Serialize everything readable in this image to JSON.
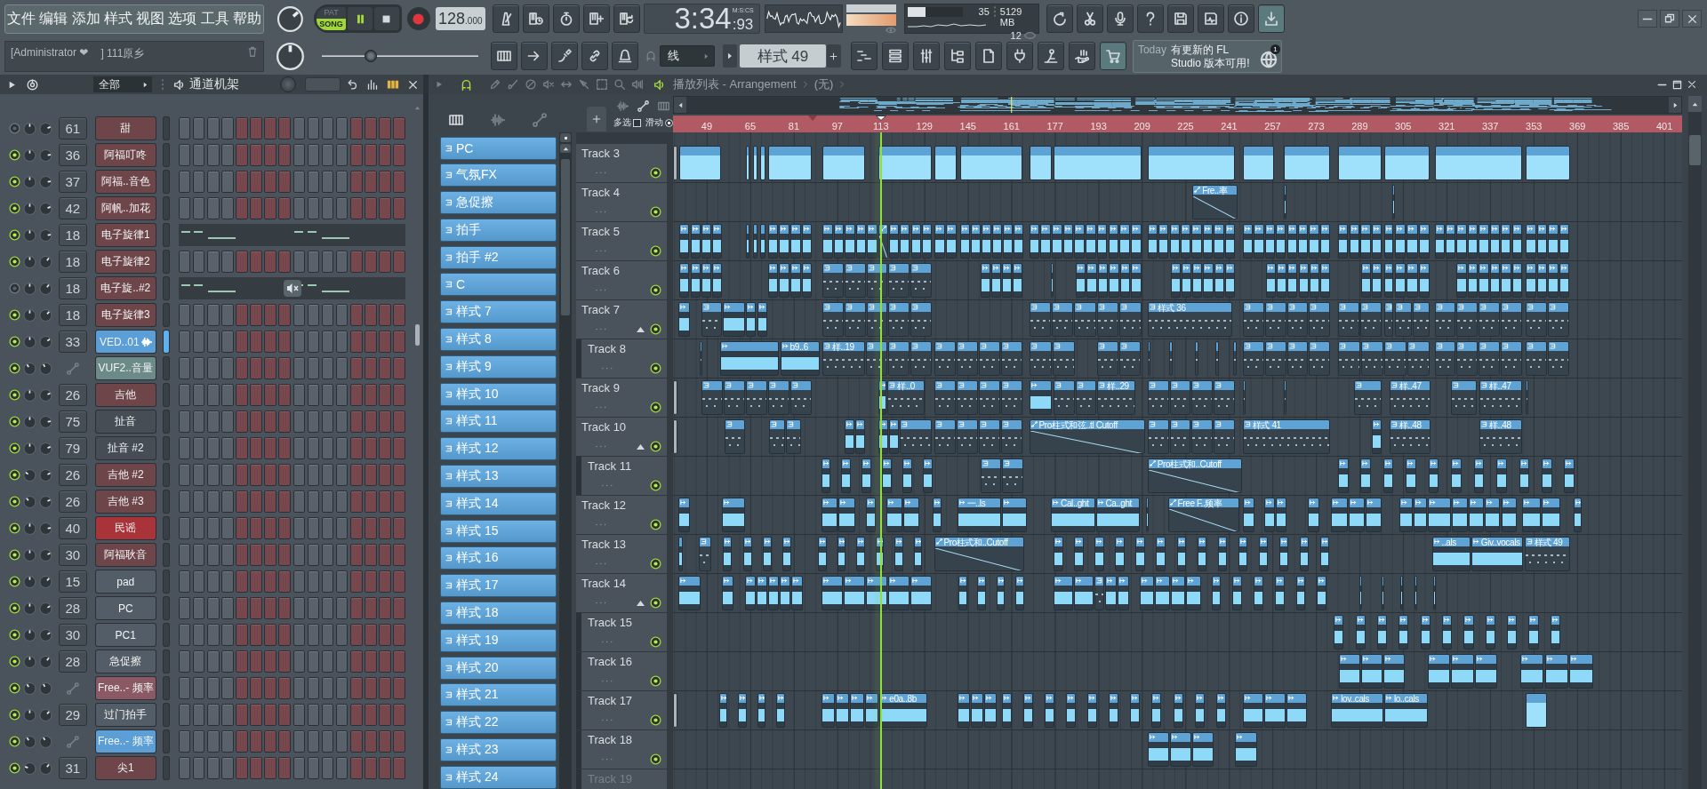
{
  "menu": [
    "文件",
    "编辑",
    "添加",
    "样式",
    "视图",
    "选项",
    "工具",
    "帮助"
  ],
  "hint": [
    "[Administrator ❤",
    "] 111原乡"
  ],
  "master_volume": {
    "level": 0.68
  },
  "master_pitch": {
    "level": 0.5
  },
  "transport": {
    "modes": [
      {
        "label": "PAT",
        "selected": false
      },
      {
        "label": "SONG",
        "selected": true
      }
    ],
    "playing": true,
    "tempo": "128",
    "tempo_fraction": ".000"
  },
  "song_position": {
    "level": 0.3
  },
  "record_tools": [
    {
      "kind": "metronome"
    },
    {
      "kind": "wait"
    },
    {
      "kind": "countdown"
    },
    {
      "kind": "step"
    },
    {
      "kind": "loop"
    }
  ],
  "time": {
    "value": "3:34",
    "centiseconds": ":93",
    "unit": "M:S:CS"
  },
  "cpu": {
    "value": "35",
    "level": 0.32,
    "memory": "5129 MB",
    "polyphony": "12"
  },
  "app_tools": [
    {
      "kind": "reload",
      "highlighted": false
    },
    {
      "kind": "cut",
      "highlighted": false
    },
    {
      "kind": "mic",
      "highlighted": false
    },
    {
      "kind": "help",
      "highlighted": false
    },
    {
      "kind": "save",
      "highlighted": false
    },
    {
      "kind": "export",
      "highlighted": false
    },
    {
      "kind": "info",
      "highlighted": false
    },
    {
      "kind": "download",
      "highlighted": true
    }
  ],
  "edit_tools": [
    {
      "kind": "keyboard"
    },
    {
      "kind": "arrow"
    },
    {
      "kind": "pen"
    },
    {
      "kind": "link"
    },
    {
      "kind": "bell"
    }
  ],
  "snap": "线",
  "pattern_selector": "样式 49",
  "view_tools": [
    {
      "kind": "playlist",
      "highlighted": false
    },
    {
      "kind": "list",
      "highlighted": false
    },
    {
      "kind": "mixer",
      "highlighted": false
    },
    {
      "kind": "browser",
      "highlighted": false
    },
    {
      "kind": "page",
      "highlighted": false
    },
    {
      "kind": "plug",
      "highlighted": false
    },
    {
      "kind": "figure",
      "highlighted": false
    },
    {
      "kind": "hand",
      "highlighted": false
    },
    {
      "kind": "cart",
      "highlighted": true
    }
  ],
  "news": {
    "label": "Today",
    "message": "有更新的 FL Studio 版本可用!",
    "badge": "1"
  },
  "channel_rack": {
    "filter": "全部",
    "title": "通道机架",
    "channels": [
      {
        "number": "61",
        "name": "甜",
        "kind": "sampler",
        "color": "#6e4649",
        "enabled": false,
        "selected": false,
        "pan": {
          "level": 0.5
        },
        "volume": {
          "level": 0.75
        }
      },
      {
        "number": "36",
        "name": "阿福叮咚",
        "kind": "sampler",
        "color": "#6e4649",
        "enabled": true,
        "selected": false,
        "pan": {
          "level": 0.5
        },
        "volume": {
          "level": 0.8
        }
      },
      {
        "number": "37",
        "name": "阿福..音色",
        "kind": "sampler",
        "color": "#6e4649",
        "enabled": true,
        "selected": false,
        "pan": {
          "level": 0.5
        },
        "volume": {
          "level": 0.8
        }
      },
      {
        "number": "42",
        "name": "阿帆..加花",
        "kind": "sampler",
        "color": "#6e4649",
        "enabled": true,
        "selected": false,
        "pan": {
          "level": 0.5
        },
        "volume": {
          "level": 0.75
        }
      },
      {
        "number": "18",
        "name": "电子旋律1",
        "kind": "pianoroll",
        "color": "#6e4649",
        "enabled": true,
        "selected": false,
        "pan": {
          "level": 0.5
        },
        "volume": {
          "level": 0.8
        }
      },
      {
        "number": "18",
        "name": "电子旋律2",
        "kind": "sampler",
        "color": "#6e4649",
        "enabled": true,
        "selected": false,
        "pan": {
          "level": 0.5
        },
        "volume": {
          "level": 0.64
        }
      },
      {
        "number": "18",
        "name": "电子旋..#2",
        "kind": "pianoroll",
        "color": "#6e4649",
        "enabled": false,
        "selected": false,
        "pan": {
          "level": 0.5
        },
        "volume": {
          "level": 0.64
        }
      },
      {
        "number": "18",
        "name": "电子旋律3",
        "kind": "sampler",
        "color": "#6e4649",
        "enabled": true,
        "selected": false,
        "pan": {
          "level": 0.5
        },
        "volume": {
          "level": 0.66
        }
      },
      {
        "number": "33",
        "name": "VED..01",
        "kind": "audio",
        "color": "#5b9fd6",
        "enabled": true,
        "selected": true,
        "pan": {
          "level": 0.5
        },
        "volume": {
          "level": 0.7
        }
      },
      {
        "name": "VUF2..音量",
        "kind": "automation",
        "color": "#6b8a88",
        "enabled": true,
        "selected": false,
        "pan": {
          "level": 0.38
        },
        "volume": {
          "level": 0.4
        }
      },
      {
        "number": "26",
        "name": "吉他",
        "kind": "sampler",
        "color": "#6e4649",
        "enabled": true,
        "selected": false,
        "pan": {
          "level": 0.5
        },
        "volume": {
          "level": 0.74
        }
      },
      {
        "number": "75",
        "name": "扯音",
        "kind": "sampler",
        "color": "#464d54",
        "enabled": true,
        "selected": false,
        "pan": {
          "level": 0.5
        },
        "volume": {
          "level": 0.8
        }
      },
      {
        "number": "79",
        "name": "扯音 #2",
        "kind": "sampler",
        "color": "#464d54",
        "enabled": true,
        "selected": false,
        "pan": {
          "level": 0.5
        },
        "volume": {
          "level": 0.75
        }
      },
      {
        "number": "26",
        "name": "吉他 #2",
        "kind": "sampler",
        "color": "#6e4649",
        "enabled": true,
        "selected": false,
        "pan": {
          "level": 0.3
        },
        "volume": {
          "level": 0.74
        }
      },
      {
        "number": "26",
        "name": "吉他 #3",
        "kind": "sampler",
        "color": "#6e4649",
        "enabled": true,
        "selected": false,
        "pan": {
          "level": 0.35
        },
        "volume": {
          "level": 0.74
        }
      },
      {
        "number": "40",
        "name": "民谣",
        "kind": "sampler",
        "color": "#a83439",
        "enabled": true,
        "selected": false,
        "pan": {
          "level": 0.5
        },
        "volume": {
          "level": 0.8
        }
      },
      {
        "number": "30",
        "name": "阿福耿音",
        "kind": "sampler",
        "color": "#6e4649",
        "enabled": true,
        "selected": false,
        "pan": {
          "level": 0.5
        },
        "volume": {
          "level": 0.74
        }
      },
      {
        "number": "15",
        "name": "pad",
        "kind": "sampler",
        "color": "#535d67",
        "enabled": true,
        "selected": false,
        "pan": {
          "level": 0.5
        },
        "volume": {
          "level": 0.66
        }
      },
      {
        "number": "28",
        "name": "PC",
        "kind": "sampler",
        "color": "#535d67",
        "enabled": true,
        "selected": false,
        "pan": {
          "level": 0.5
        },
        "volume": {
          "level": 0.72
        }
      },
      {
        "number": "30",
        "name": "PC1",
        "kind": "sampler",
        "color": "#535d67",
        "enabled": true,
        "selected": false,
        "pan": {
          "level": 0.5
        },
        "volume": {
          "level": 0.72
        }
      },
      {
        "number": "28",
        "name": "急促擦",
        "kind": "sampler",
        "color": "#535d67",
        "enabled": true,
        "selected": false,
        "pan": {
          "level": 0.5
        },
        "volume": {
          "level": 0.64
        }
      },
      {
        "name": "Free..- 频率",
        "kind": "automation",
        "color": "#8b5963",
        "enabled": true,
        "selected": false,
        "pan": {
          "level": 0.38
        },
        "volume": {
          "level": 0.4
        }
      },
      {
        "number": "29",
        "name": "过门拍手",
        "kind": "sampler",
        "color": "#535d67",
        "enabled": true,
        "selected": false,
        "pan": {
          "level": 0.5
        },
        "volume": {
          "level": 0.66
        }
      },
      {
        "name": "Free..- 频率",
        "kind": "automation",
        "color": "#5b9fd6",
        "enabled": true,
        "selected": false,
        "pan": {
          "level": 0.38
        },
        "volume": {
          "level": 0.4
        }
      },
      {
        "number": "31",
        "name": "尖1",
        "kind": "sampler",
        "color": "#6e4649",
        "enabled": true,
        "selected": false,
        "pan": {
          "level": 0.25
        },
        "volume": {
          "level": 0.64
        }
      }
    ]
  },
  "pattern_picker": {
    "tabs": [
      {
        "kind": "patterns",
        "selected": true
      },
      {
        "kind": "audio",
        "selected": false
      },
      {
        "kind": "automation",
        "selected": false
      }
    ],
    "patterns": [
      "PC",
      "气氛FX",
      "急促擦",
      "拍手",
      "拍手 #2",
      "C",
      "样式 7",
      "样式 8",
      "样式 9",
      "样式 10",
      "样式 11",
      "样式 12",
      "样式 13",
      "样式 14",
      "样式 15",
      "样式 16",
      "样式 17",
      "样式 18",
      "样式 19",
      "样式 20",
      "样式 21",
      "样式 22",
      "样式 23",
      "样式 24"
    ]
  },
  "playlist": {
    "title": "播放列表 - Arrangement",
    "arrangement": "(无)",
    "options": [
      {
        "kind": "checkbox",
        "label": "多选",
        "checked": false
      },
      {
        "kind": "radio",
        "label": "滑动",
        "checked": true
      }
    ],
    "ruler": [
      "49",
      "65",
      "81",
      "97",
      "113",
      "129",
      "145",
      "161",
      "177",
      "193",
      "209",
      "225",
      "241",
      "257",
      "273",
      "289",
      "305",
      "321",
      "337",
      "353",
      "369",
      "385",
      "401"
    ],
    "tracks": [
      {
        "name": "Track 3",
        "enabled": true,
        "clips": [
          {
            "kind": "ghost"
          },
          {
            "kind": "sample"
          },
          {
            "kind": "sample"
          },
          {
            "kind": "sample"
          },
          {
            "kind": "sample"
          },
          {
            "kind": "sample"
          },
          {
            "kind": "sample"
          },
          {
            "kind": "sample"
          },
          {
            "kind": "sample"
          },
          {
            "kind": "sample"
          },
          {
            "kind": "sample"
          },
          {
            "kind": "sample"
          },
          {
            "kind": "sample"
          },
          {
            "kind": "sample"
          },
          {
            "kind": "sample"
          },
          {
            "kind": "sample"
          },
          {
            "kind": "sample"
          },
          {
            "kind": "sample"
          },
          {
            "kind": "sample"
          }
        ]
      },
      {
        "name": "Track 4",
        "enabled": true,
        "clips": [
          {
            "kind": "automation",
            "label": "Fre..率"
          },
          {
            "kind": "audio"
          },
          {
            "kind": "audio"
          }
        ]
      },
      {
        "name": "Track 5",
        "enabled": true,
        "clips": [
          {
            "kind": "audio"
          },
          {
            "kind": "audio"
          },
          {
            "kind": "audio"
          },
          {
            "kind": "audio"
          },
          {
            "kind": "audio"
          },
          {
            "kind": "audio"
          },
          {
            "kind": "audio"
          },
          {
            "kind": "audio"
          },
          {
            "kind": "audio"
          },
          {
            "kind": "audio"
          },
          {
            "kind": "audio"
          },
          {
            "kind": "audio"
          },
          {
            "kind": "audio"
          },
          {
            "kind": "audio"
          },
          {
            "kind": "audio"
          },
          {
            "kind": "audio"
          },
          {
            "kind": "automation"
          },
          {
            "kind": "audio"
          },
          {
            "kind": "audio"
          },
          {
            "kind": "audio"
          },
          {
            "kind": "audio"
          },
          {
            "kind": "audio"
          },
          {
            "kind": "audio"
          },
          {
            "kind": "audio"
          },
          {
            "kind": "audio"
          },
          {
            "kind": "audio"
          },
          {
            "kind": "audio"
          },
          {
            "kind": "audio"
          },
          {
            "kind": "audio"
          },
          {
            "kind": "audio"
          },
          {
            "kind": "audio"
          },
          {
            "kind": "audio"
          },
          {
            "kind": "audio"
          },
          {
            "kind": "audio"
          },
          {
            "kind": "audio"
          },
          {
            "kind": "audio"
          },
          {
            "kind": "audio"
          },
          {
            "kind": "audio"
          },
          {
            "kind": "audio"
          },
          {
            "kind": "audio"
          },
          {
            "kind": "audio"
          },
          {
            "kind": "audio"
          },
          {
            "kind": "audio"
          },
          {
            "kind": "audio"
          },
          {
            "kind": "audio"
          },
          {
            "kind": "audio"
          },
          {
            "kind": "audio"
          },
          {
            "kind": "audio"
          },
          {
            "kind": "audio"
          },
          {
            "kind": "audio"
          },
          {
            "kind": "audio"
          },
          {
            "kind": "audio"
          },
          {
            "kind": "audio"
          },
          {
            "kind": "audio"
          },
          {
            "kind": "audio"
          },
          {
            "kind": "audio"
          },
          {
            "kind": "audio"
          },
          {
            "kind": "audio"
          },
          {
            "kind": "audio"
          },
          {
            "kind": "audio"
          },
          {
            "kind": "audio"
          },
          {
            "kind": "audio"
          },
          {
            "kind": "audio"
          },
          {
            "kind": "audio"
          },
          {
            "kind": "audio"
          },
          {
            "kind": "audio"
          },
          {
            "kind": "audio"
          },
          {
            "kind": "audio"
          },
          {
            "kind": "audio"
          },
          {
            "kind": "audio"
          },
          {
            "kind": "audio"
          },
          {
            "kind": "audio"
          },
          {
            "kind": "audio"
          },
          {
            "kind": "audio"
          },
          {
            "kind": "audio"
          }
        ]
      },
      {
        "name": "Track 6",
        "enabled": true,
        "clips": [
          {
            "kind": "audio"
          },
          {
            "kind": "audio"
          },
          {
            "kind": "audio"
          },
          {
            "kind": "audio"
          },
          {
            "kind": "audio"
          },
          {
            "kind": "audio"
          },
          {
            "kind": "audio"
          },
          {
            "kind": "audio"
          },
          {
            "kind": "pattern"
          },
          {
            "kind": "pattern"
          },
          {
            "kind": "pattern"
          },
          {
            "kind": "pattern"
          },
          {
            "kind": "pattern"
          },
          {
            "kind": "audio"
          },
          {
            "kind": "audio"
          },
          {
            "kind": "audio"
          },
          {
            "kind": "audio"
          },
          {
            "kind": "audio"
          },
          {
            "kind": "audio"
          },
          {
            "kind": "audio"
          },
          {
            "kind": "audio"
          },
          {
            "kind": "audio"
          },
          {
            "kind": "audio"
          },
          {
            "kind": "audio"
          },
          {
            "kind": "audio"
          },
          {
            "kind": "audio"
          },
          {
            "kind": "audio"
          },
          {
            "kind": "audio"
          },
          {
            "kind": "audio"
          },
          {
            "kind": "audio"
          },
          {
            "kind": "audio"
          },
          {
            "kind": "audio"
          },
          {
            "kind": "audio"
          },
          {
            "kind": "audio"
          },
          {
            "kind": "audio"
          },
          {
            "kind": "audio"
          },
          {
            "kind": "audio"
          },
          {
            "kind": "audio"
          },
          {
            "kind": "audio"
          },
          {
            "kind": "audio"
          },
          {
            "kind": "audio"
          },
          {
            "kind": "audio"
          },
          {
            "kind": "audio"
          },
          {
            "kind": "audio"
          },
          {
            "kind": "audio"
          },
          {
            "kind": "audio"
          },
          {
            "kind": "audio"
          },
          {
            "kind": "audio"
          },
          {
            "kind": "audio"
          },
          {
            "kind": "audio"
          },
          {
            "kind": "audio"
          },
          {
            "kind": "audio"
          }
        ]
      },
      {
        "name": "Track 7",
        "enabled": true,
        "expanded": true,
        "clips": [
          {
            "kind": "audio"
          },
          {
            "kind": "pattern"
          },
          {
            "kind": "audio"
          },
          {
            "kind": "audio"
          },
          {
            "kind": "audio"
          },
          {
            "kind": "pattern"
          },
          {
            "kind": "pattern"
          },
          {
            "kind": "pattern"
          },
          {
            "kind": "pattern"
          },
          {
            "kind": "pattern"
          },
          {
            "kind": "pattern"
          },
          {
            "kind": "pattern"
          },
          {
            "kind": "pattern"
          },
          {
            "kind": "pattern"
          },
          {
            "kind": "pattern"
          },
          {
            "kind": "pattern",
            "label": "样式 36"
          },
          {
            "kind": "pattern"
          },
          {
            "kind": "pattern"
          },
          {
            "kind": "pattern"
          },
          {
            "kind": "pattern"
          },
          {
            "kind": "pattern"
          },
          {
            "kind": "pattern"
          },
          {
            "kind": "pattern"
          },
          {
            "kind": "pattern"
          },
          {
            "kind": "pattern"
          },
          {
            "kind": "pattern"
          },
          {
            "kind": "pattern"
          },
          {
            "kind": "pattern"
          },
          {
            "kind": "pattern"
          },
          {
            "kind": "pattern"
          },
          {
            "kind": "pattern"
          }
        ],
        "children": [
          {
            "name": "Track 8",
            "enabled": true,
            "clips": [
              {
                "kind": "pattern"
              },
              {
                "kind": "audio"
              },
              {
                "kind": "audio",
                "label": "b9..6"
              },
              {
                "kind": "pattern",
                "label": "样..19"
              },
              {
                "kind": "pattern"
              },
              {
                "kind": "pattern"
              },
              {
                "kind": "pattern"
              },
              {
                "kind": "pattern"
              },
              {
                "kind": "pattern"
              },
              {
                "kind": "pattern"
              },
              {
                "kind": "pattern"
              },
              {
                "kind": "pattern"
              },
              {
                "kind": "pattern"
              },
              {
                "kind": "pattern"
              },
              {
                "kind": "pattern"
              },
              {
                "kind": "pattern"
              },
              {
                "kind": "pattern"
              },
              {
                "kind": "pattern"
              },
              {
                "kind": "pattern"
              },
              {
                "kind": "pattern"
              },
              {
                "kind": "pattern"
              },
              {
                "kind": "pattern"
              },
              {
                "kind": "pattern"
              },
              {
                "kind": "pattern"
              },
              {
                "kind": "pattern"
              },
              {
                "kind": "pattern"
              },
              {
                "kind": "pattern"
              },
              {
                "kind": "pattern"
              },
              {
                "kind": "pattern"
              },
              {
                "kind": "pattern"
              },
              {
                "kind": "pattern"
              },
              {
                "kind": "pattern"
              },
              {
                "kind": "pattern"
              },
              {
                "kind": "pattern"
              }
            ]
          }
        ]
      },
      {
        "name": "Track 9",
        "enabled": true,
        "clips": [
          {
            "kind": "ghost"
          },
          {
            "kind": "pattern"
          },
          {
            "kind": "pattern"
          },
          {
            "kind": "pattern"
          },
          {
            "kind": "pattern"
          },
          {
            "kind": "pattern"
          },
          {
            "kind": "audio"
          },
          {
            "kind": "pattern",
            "label": "样..0"
          },
          {
            "kind": "pattern"
          },
          {
            "kind": "pattern"
          },
          {
            "kind": "pattern"
          },
          {
            "kind": "pattern"
          },
          {
            "kind": "audio"
          },
          {
            "kind": "pattern"
          },
          {
            "kind": "pattern"
          },
          {
            "kind": "pattern",
            "label": "样..29"
          },
          {
            "kind": "pattern"
          },
          {
            "kind": "pattern"
          },
          {
            "kind": "pattern"
          },
          {
            "kind": "pattern"
          },
          {
            "kind": "pattern"
          },
          {
            "kind": "pattern"
          },
          {
            "kind": "pattern"
          },
          {
            "kind": "pattern",
            "label": "样..47"
          },
          {
            "kind": "pattern"
          },
          {
            "kind": "pattern",
            "label": "样..47"
          },
          {
            "kind": "pattern"
          }
        ]
      },
      {
        "name": "Track 10",
        "enabled": true,
        "expanded": true,
        "clips": [
          {
            "kind": "ghost"
          },
          {
            "kind": "pattern"
          },
          {
            "kind": "pattern"
          },
          {
            "kind": "pattern"
          },
          {
            "kind": "audio"
          },
          {
            "kind": "audio"
          },
          {
            "kind": "audio"
          },
          {
            "kind": "audio"
          },
          {
            "kind": "pattern"
          },
          {
            "kind": "pattern"
          },
          {
            "kind": "pattern"
          },
          {
            "kind": "pattern"
          },
          {
            "kind": "pattern"
          },
          {
            "kind": "automation",
            "label": "Pro柱式和弦..tl Cutoff"
          },
          {
            "kind": "pattern"
          },
          {
            "kind": "pattern"
          },
          {
            "kind": "pattern"
          },
          {
            "kind": "pattern"
          },
          {
            "kind": "pattern",
            "label": "样式 41"
          },
          {
            "kind": "audio"
          },
          {
            "kind": "pattern",
            "label": "样..48"
          },
          {
            "kind": "pattern",
            "label": "样..48"
          }
        ],
        "children": [
          {
            "name": "Track 11",
            "enabled": true,
            "clips": [
              {
                "kind": "audio"
              },
              {
                "kind": "audio"
              },
              {
                "kind": "audio"
              },
              {
                "kind": "audio"
              },
              {
                "kind": "audio"
              },
              {
                "kind": "audio"
              },
              {
                "kind": "pattern"
              },
              {
                "kind": "pattern"
              },
              {
                "kind": "automation",
                "label": "Pro柱式和..Cutoff"
              },
              {
                "kind": "audio"
              },
              {
                "kind": "audio"
              },
              {
                "kind": "audio"
              },
              {
                "kind": "audio"
              },
              {
                "kind": "audio"
              },
              {
                "kind": "audio"
              },
              {
                "kind": "audio"
              },
              {
                "kind": "audio"
              },
              {
                "kind": "audio"
              },
              {
                "kind": "audio"
              },
              {
                "kind": "audio"
              }
            ]
          }
        ]
      },
      {
        "name": "Track 12",
        "enabled": true,
        "clips": [
          {
            "kind": "audio"
          },
          {
            "kind": "audio"
          },
          {
            "kind": "audio"
          },
          {
            "kind": "audio"
          },
          {
            "kind": "audio"
          },
          {
            "kind": "audio"
          },
          {
            "kind": "audio"
          },
          {
            "kind": "audio"
          },
          {
            "kind": "audio",
            "label": "一..ls"
          },
          {
            "kind": "audio"
          },
          {
            "kind": "audio",
            "label": "Cal..ght"
          },
          {
            "kind": "audio",
            "label": "Ca..ght"
          },
          {
            "kind": "audio"
          },
          {
            "kind": "automation",
            "label": "Free F..频率"
          },
          {
            "kind": "audio"
          },
          {
            "kind": "audio"
          },
          {
            "kind": "audio"
          },
          {
            "kind": "audio"
          },
          {
            "kind": "audio"
          },
          {
            "kind": "audio"
          },
          {
            "kind": "audio"
          },
          {
            "kind": "audio"
          },
          {
            "kind": "audio"
          },
          {
            "kind": "audio"
          },
          {
            "kind": "audio"
          },
          {
            "kind": "audio"
          },
          {
            "kind": "audio"
          },
          {
            "kind": "audio"
          },
          {
            "kind": "audio"
          },
          {
            "kind": "audio"
          },
          {
            "kind": "audio"
          }
        ]
      },
      {
        "name": "Track 13",
        "enabled": true,
        "clips": [
          {
            "kind": "audio"
          },
          {
            "kind": "pattern"
          },
          {
            "kind": "audio"
          },
          {
            "kind": "audio"
          },
          {
            "kind": "audio"
          },
          {
            "kind": "audio"
          },
          {
            "kind": "audio"
          },
          {
            "kind": "audio"
          },
          {
            "kind": "audio"
          },
          {
            "kind": "audio"
          },
          {
            "kind": "audio"
          },
          {
            "kind": "audio"
          },
          {
            "kind": "automation",
            "label": "Pro柱式和..Cutoff"
          },
          {
            "kind": "audio"
          },
          {
            "kind": "audio"
          },
          {
            "kind": "audio"
          },
          {
            "kind": "audio"
          },
          {
            "kind": "audio"
          },
          {
            "kind": "audio"
          },
          {
            "kind": "audio"
          },
          {
            "kind": "audio"
          },
          {
            "kind": "audio"
          },
          {
            "kind": "audio"
          },
          {
            "kind": "audio"
          },
          {
            "kind": "audio"
          },
          {
            "kind": "audio"
          },
          {
            "kind": "audio"
          },
          {
            "kind": "audio",
            "label": "..als"
          },
          {
            "kind": "audio",
            "label": "Giv..vocals"
          },
          {
            "kind": "pattern",
            "label": "样式 49"
          }
        ]
      },
      {
        "name": "Track 14",
        "enabled": true,
        "expanded": true,
        "clips": [
          {
            "kind": "audio"
          },
          {
            "kind": "audio"
          },
          {
            "kind": "audio"
          },
          {
            "kind": "audio"
          },
          {
            "kind": "audio"
          },
          {
            "kind": "audio"
          },
          {
            "kind": "audio"
          },
          {
            "kind": "audio"
          },
          {
            "kind": "audio"
          },
          {
            "kind": "audio"
          },
          {
            "kind": "audio"
          },
          {
            "kind": "audio"
          },
          {
            "kind": "audio"
          },
          {
            "kind": "audio"
          },
          {
            "kind": "audio"
          },
          {
            "kind": "audio"
          },
          {
            "kind": "audio"
          },
          {
            "kind": "audio"
          },
          {
            "kind": "pattern"
          },
          {
            "kind": "audio"
          },
          {
            "kind": "audio"
          },
          {
            "kind": "audio"
          },
          {
            "kind": "audio"
          },
          {
            "kind": "audio"
          },
          {
            "kind": "audio"
          },
          {
            "kind": "audio"
          },
          {
            "kind": "audio"
          },
          {
            "kind": "audio"
          },
          {
            "kind": "audio"
          },
          {
            "kind": "audio"
          },
          {
            "kind": "audio"
          },
          {
            "kind": "audio"
          },
          {
            "kind": "audio"
          },
          {
            "kind": "audio"
          },
          {
            "kind": "audio"
          },
          {
            "kind": "audio"
          }
        ],
        "children": [
          {
            "name": "Track 15",
            "enabled": true,
            "clips": [
              {
                "kind": "audio"
              },
              {
                "kind": "audio"
              },
              {
                "kind": "audio"
              },
              {
                "kind": "audio"
              },
              {
                "kind": "audio"
              },
              {
                "kind": "audio"
              },
              {
                "kind": "audio"
              },
              {
                "kind": "audio"
              },
              {
                "kind": "audio"
              },
              {
                "kind": "audio"
              },
              {
                "kind": "audio"
              }
            ]
          },
          {
            "name": "Track 16",
            "enabled": true,
            "clips": [
              {
                "kind": "audio"
              },
              {
                "kind": "audio"
              },
              {
                "kind": "audio"
              },
              {
                "kind": "audio"
              },
              {
                "kind": "audio"
              },
              {
                "kind": "audio"
              },
              {
                "kind": "audio"
              },
              {
                "kind": "audio"
              },
              {
                "kind": "audio"
              }
            ]
          },
          {
            "name": "Track 17",
            "enabled": true,
            "clips": [
              {
                "kind": "ghost"
              },
              {
                "kind": "audio"
              },
              {
                "kind": "audio"
              },
              {
                "kind": "audio"
              },
              {
                "kind": "audio"
              },
              {
                "kind": "audio"
              },
              {
                "kind": "audio"
              },
              {
                "kind": "audio"
              },
              {
                "kind": "audio"
              },
              {
                "kind": "audio",
                "label": "e0a..8b"
              },
              {
                "kind": "audio"
              },
              {
                "kind": "audio"
              },
              {
                "kind": "audio"
              },
              {
                "kind": "audio"
              },
              {
                "kind": "audio"
              },
              {
                "kind": "audio"
              },
              {
                "kind": "audio"
              },
              {
                "kind": "audio"
              },
              {
                "kind": "audio"
              },
              {
                "kind": "audio"
              },
              {
                "kind": "audio"
              },
              {
                "kind": "audio"
              },
              {
                "kind": "audio"
              },
              {
                "kind": "audio"
              },
              {
                "kind": "audio"
              },
              {
                "kind": "audio"
              },
              {
                "kind": "audio"
              },
              {
                "kind": "audio",
                "label": "lov..cals"
              },
              {
                "kind": "audio",
                "label": "lo..cals"
              },
              {
                "kind": "sample"
              }
            ]
          },
          {
            "name": "Track 18",
            "enabled": true,
            "clips": [
              {
                "kind": "audio"
              },
              {
                "kind": "audio"
              },
              {
                "kind": "audio"
              },
              {
                "kind": "audio"
              }
            ]
          },
          {
            "name": "Track 19",
            "enabled": false
          }
        ]
      }
    ]
  }
}
